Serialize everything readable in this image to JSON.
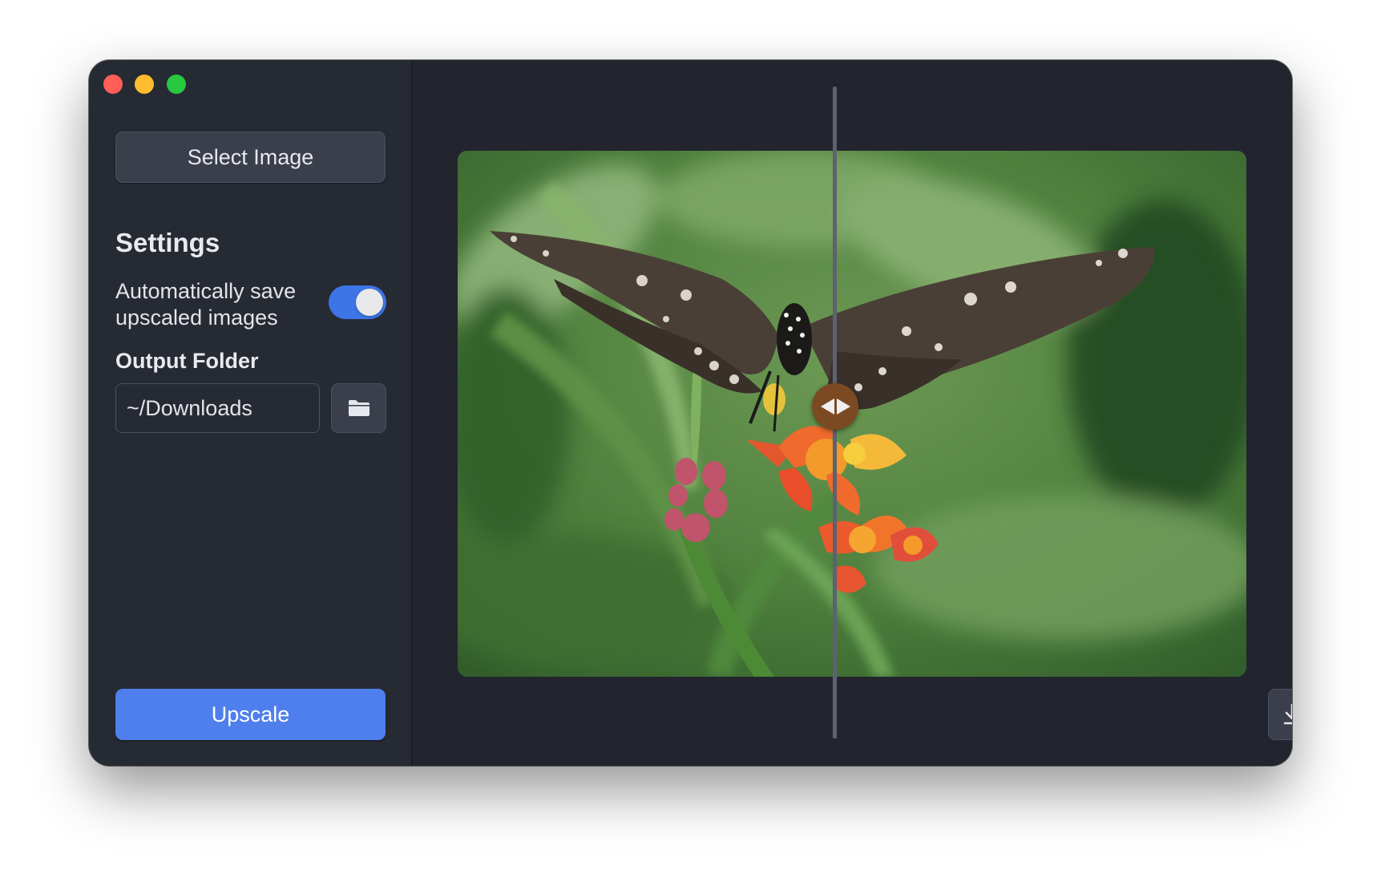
{
  "window": {
    "traffic_lights": [
      "close",
      "minimize",
      "maximize"
    ]
  },
  "sidebar": {
    "select_image_label": "Select Image",
    "settings_title": "Settings",
    "auto_save": {
      "label": "Automatically save upscaled images",
      "enabled": true
    },
    "output_folder": {
      "label": "Output Folder",
      "value": "~/Downloads",
      "browse_icon": "folder-icon"
    },
    "upscale_label": "Upscale"
  },
  "main": {
    "image_subject": "butterfly on flowers (before/after comparison)",
    "comparison_split": 0.48,
    "download_icon": "download-icon"
  },
  "colors": {
    "window_bg": "#22252e",
    "sidebar_bg": "#262a33",
    "accent": "#4f7fec",
    "toggle_on": "#3d74e6",
    "handle": "#7b4a23"
  }
}
